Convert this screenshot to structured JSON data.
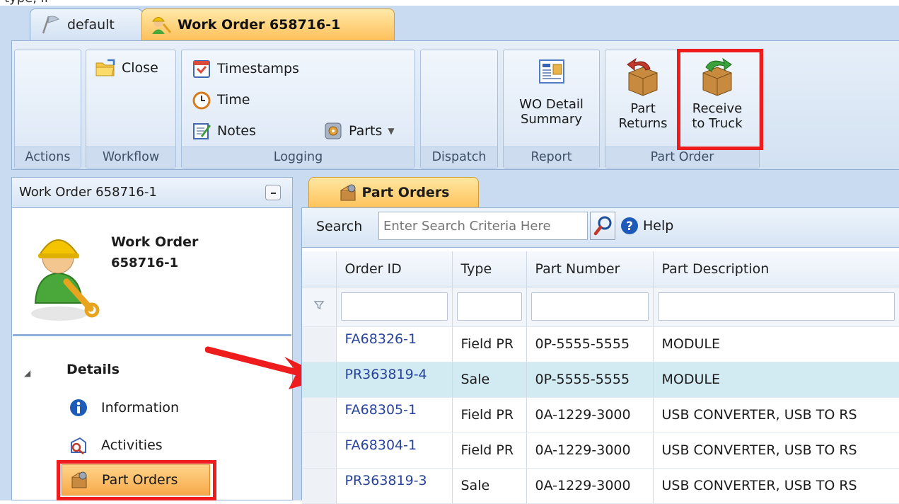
{
  "header": {
    "fragment": "type, if"
  },
  "tabs": [
    {
      "label": "default"
    },
    {
      "label": "Work Order 658716-1"
    }
  ],
  "ribbon": {
    "groups": {
      "actions": "Actions",
      "workflow": "Workflow",
      "logging": "Logging",
      "dispatch": "Dispatch",
      "report": "Report",
      "part_order": "Part Order"
    },
    "buttons": {
      "close": "Close",
      "timestamps": "Timestamps",
      "time": "Time",
      "notes": "Notes",
      "parts": "Parts",
      "wo_detail_line1": "WO Detail",
      "wo_detail_line2": "Summary",
      "part_returns_line1": "Part",
      "part_returns_line2": "Returns",
      "receive_line1": "Receive",
      "receive_line2": "to Truck"
    }
  },
  "left_panel": {
    "title": "Work Order 658716-1",
    "heading_line1": "Work Order",
    "heading_line2": "658716-1",
    "section": "Details",
    "nav": [
      "Information",
      "Activities",
      "Part Orders"
    ]
  },
  "content": {
    "tab": "Part Orders",
    "search_label": "Search",
    "search_placeholder": "Enter Search Criteria Here",
    "help": "Help",
    "columns": [
      "Order ID",
      "Type",
      "Part Number",
      "Part Description"
    ],
    "rows": [
      {
        "order_id": "FA68326-1",
        "type": "Field PR",
        "part_number": "0P-5555-5555",
        "description": "MODULE"
      },
      {
        "order_id": "PR363819-4",
        "type": "Sale",
        "part_number": "0P-5555-5555",
        "description": "MODULE"
      },
      {
        "order_id": "FA68305-1",
        "type": "Field PR",
        "part_number": "0A-1229-3000",
        "description": "USB CONVERTER, USB TO RS"
      },
      {
        "order_id": "FA68304-1",
        "type": "Field PR",
        "part_number": "0A-1229-3000",
        "description": "USB CONVERTER, USB TO RS"
      },
      {
        "order_id": "PR363819-3",
        "type": "Sale",
        "part_number": "0A-1229-3000",
        "description": "USB CONVERTER, USB TO RS"
      }
    ]
  },
  "colors": {
    "highlight_red": "#ee1c1c",
    "selected_row": "#d2eaf1",
    "active_tab": "#ffc35c"
  }
}
